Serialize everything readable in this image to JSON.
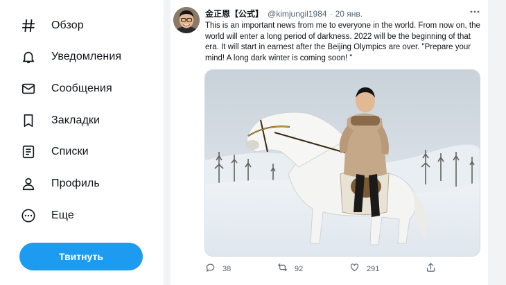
{
  "nav": {
    "items": [
      {
        "label": "Обзор",
        "icon": "hashtag-icon"
      },
      {
        "label": "Уведомления",
        "icon": "bell-icon"
      },
      {
        "label": "Сообщения",
        "icon": "envelope-icon"
      },
      {
        "label": "Закладки",
        "icon": "bookmark-icon"
      },
      {
        "label": "Списки",
        "icon": "list-icon"
      },
      {
        "label": "Профиль",
        "icon": "person-icon"
      },
      {
        "label": "Еще",
        "icon": "more-circle-icon"
      }
    ],
    "tweet_button_label": "Твитнуть"
  },
  "tweet": {
    "display_name": "金正恩【公式】",
    "handle": "@kimjungil1984",
    "separator": "·",
    "time": "20 янв.",
    "text": "This is an important news from me to everyone in the world. From now on, the world will enter a long period of darkness. 2022 will be the beginning of that era. It will start in earnest after the Beijing Olympics are over. \"Prepare your mind! A long dark winter is coming soon! \"",
    "media_icon": "photo-snowy-landscape-rider-on-white-horse",
    "actions": {
      "reply_count": "38",
      "retweet_count": "92",
      "like_count": "291"
    }
  },
  "colors": {
    "accent": "#1d9bf0",
    "text": "#0f1419",
    "muted": "#536471",
    "gutter": "#f2f3f4"
  }
}
